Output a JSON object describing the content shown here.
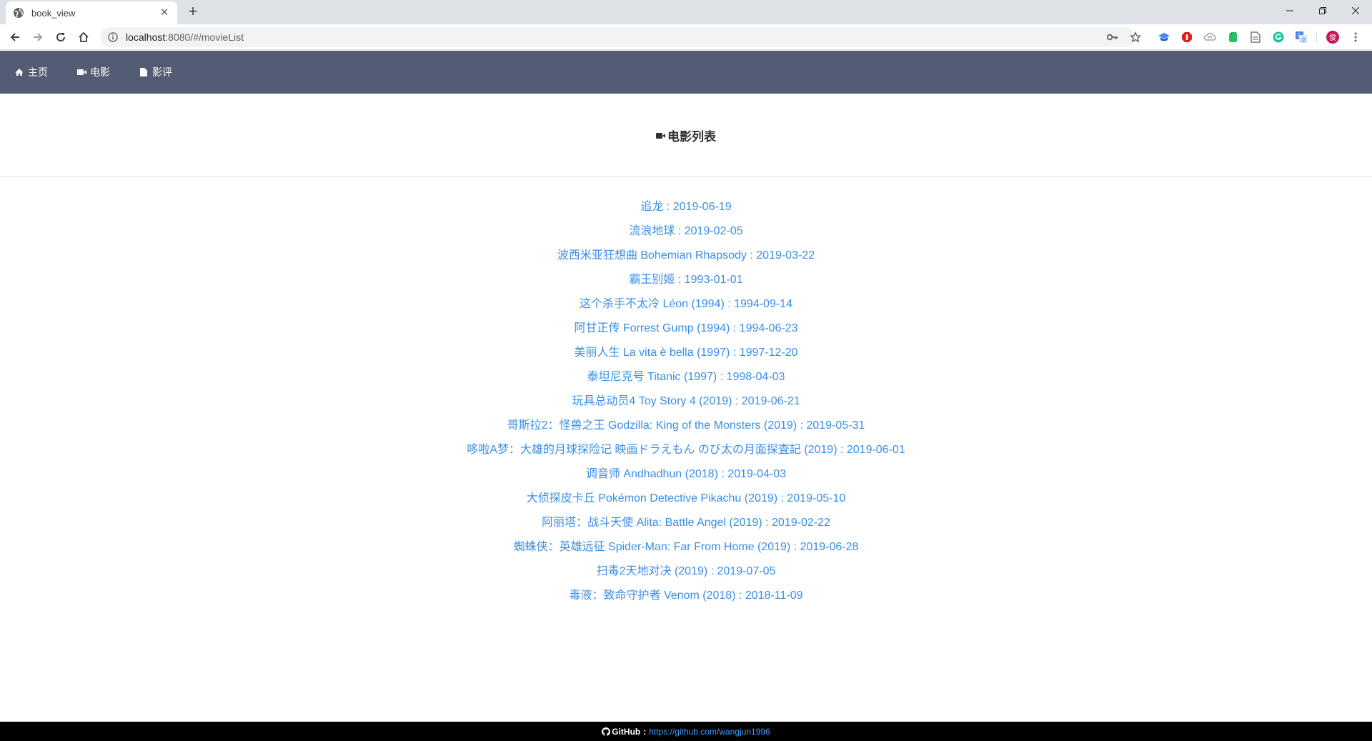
{
  "browser": {
    "tab_title": "book_view",
    "url_host": "localhost",
    "url_path": ":8080/#/movieList"
  },
  "nav": {
    "items": [
      {
        "label": "主页",
        "icon": "home-icon"
      },
      {
        "label": "电影",
        "icon": "video-camera-icon"
      },
      {
        "label": "影评",
        "icon": "document-icon"
      }
    ]
  },
  "header": {
    "title": "电影列表",
    "icon": "video-camera-icon"
  },
  "movies": [
    {
      "title": "追龙",
      "date": "2019-06-19"
    },
    {
      "title": "流浪地球",
      "date": "2019-02-05"
    },
    {
      "title": "波西米亚狂想曲 Bohemian Rhapsody",
      "date": "2019-03-22"
    },
    {
      "title": "霸王别姬",
      "date": "1993-01-01"
    },
    {
      "title": "这个杀手不太冷 Léon (1994)",
      "date": "1994-09-14"
    },
    {
      "title": "阿甘正传 Forrest Gump (1994)",
      "date": "1994-06-23"
    },
    {
      "title": "美丽人生 La vita è bella (1997)",
      "date": "1997-12-20"
    },
    {
      "title": "泰坦尼克号 Titanic (1997)",
      "date": "1998-04-03"
    },
    {
      "title": "玩具总动员4 Toy Story 4 (2019)",
      "date": "2019-06-21"
    },
    {
      "title": "哥斯拉2：怪兽之王 Godzilla: King of the Monsters (2019)",
      "date": "2019-05-31"
    },
    {
      "title": "哆啦A梦：大雄的月球探险记 映画ドラえもん のび太の月面探査記 (2019)",
      "date": "2019-06-01"
    },
    {
      "title": "调音师 Andhadhun (2018)",
      "date": "2019-04-03"
    },
    {
      "title": "大侦探皮卡丘 Pokémon Detective Pikachu (2019)",
      "date": "2019-05-10"
    },
    {
      "title": "阿丽塔：战斗天使 Alita: Battle Angel (2019)",
      "date": "2019-02-22"
    },
    {
      "title": "蜘蛛侠：英雄远征 Spider-Man: Far From Home (2019)",
      "date": "2019-06-28"
    },
    {
      "title": "扫毒2天地对决 (2019)",
      "date": "2019-07-05"
    },
    {
      "title": "毒液：致命守护者 Venom (2018)",
      "date": "2018-11-09"
    }
  ],
  "separator": " : ",
  "footer": {
    "label": "GitHub",
    "separator": ":",
    "link": "https://github.com/wangjun1996"
  },
  "colors": {
    "nav_bg": "#545c73",
    "link": "#3a8ee6",
    "footer_bg": "#000000"
  }
}
